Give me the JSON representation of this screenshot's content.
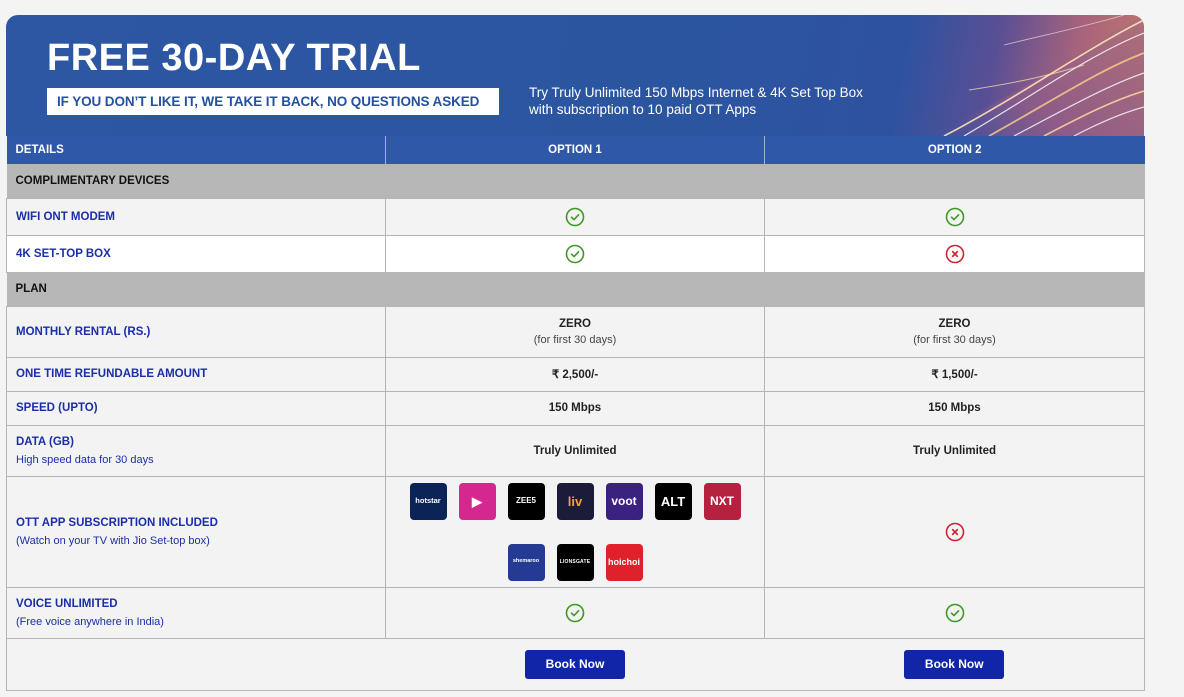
{
  "banner": {
    "title": "FREE 30-DAY TRIAL",
    "tagline": "IF YOU DON’T LIKE IT, WE TAKE IT BACK, NO QUESTIONS ASKED",
    "subtitle_line1": "Try Truly Unlimited 150 Mbps Internet & 4K Set Top Box",
    "subtitle_line2": "with subscription to 10 paid OTT Apps"
  },
  "table": {
    "headers": [
      "DETAILS",
      "OPTION 1",
      "OPTION 2"
    ],
    "sections": {
      "devices": "COMPLIMENTARY DEVICES",
      "plan": "PLAN"
    },
    "rows": {
      "wifi": {
        "label": "WIFI ONT MODEM",
        "option1": "check-icon",
        "option2": "check-icon"
      },
      "stb": {
        "label": "4K SET-TOP BOX",
        "option1": "check-icon",
        "option2": "cross-icon"
      },
      "rental": {
        "label": "MONTHLY RENTAL (RS.)",
        "option1_main": "ZERO",
        "option1_sub": "(for first 30 days)",
        "option2_main": "ZERO",
        "option2_sub": "(for first 30 days)"
      },
      "refundable": {
        "label": "ONE TIME REFUNDABLE AMOUNT",
        "option1": "₹ 2,500/-",
        "option2": "₹ 1,500/-"
      },
      "speed": {
        "label": "SPEED (UPTO)",
        "option1": "150 Mbps",
        "option2": "150 Mbps"
      },
      "data": {
        "label": "DATA (GB)",
        "sublabel": "High speed data for 30 days",
        "option1": "Truly Unlimited",
        "option2": "Truly Unlimited"
      },
      "ott": {
        "label": "OTT APP SUBSCRIPTION INCLUDED",
        "sublabel": "(Watch on your TV with Jio Set-top box)",
        "option1_apps": [
          {
            "name": "Disney+ Hotstar",
            "text": "hotstar",
            "bg": "#0c2358"
          },
          {
            "name": "JioCinema",
            "text": "▶",
            "bg": "#d5288e"
          },
          {
            "name": "ZEE5",
            "text": "ZEE5",
            "bg": "#000000"
          },
          {
            "name": "Sony LIV",
            "text": "liv",
            "bg": "#1b1b3a"
          },
          {
            "name": "Voot",
            "text": "voot",
            "bg": "#3b2180"
          },
          {
            "name": "ALTBalaji",
            "text": "ALT",
            "bg": "#000000"
          },
          {
            "name": "Sun NXT",
            "text": "NXT",
            "bg": "#b5213f"
          },
          {
            "name": "Shemaroo",
            "text": "shemaroo",
            "bg": "#253a92"
          },
          {
            "name": "Lionsgate Play",
            "text": "LIONSGATE",
            "bg": "#000000"
          },
          {
            "name": "Hoichoi",
            "text": "hoichoi",
            "bg": "#e0202b"
          }
        ],
        "option2": "cross-icon"
      },
      "voice": {
        "label": "VOICE UNLIMITED",
        "sublabel": "(Free voice anywhere in India)",
        "option1": "check-icon",
        "option2": "check-icon"
      }
    },
    "book_label": "Book Now"
  },
  "colors": {
    "accent_blue": "#2f58a8",
    "label_blue": "#1a2ea8",
    "button_blue": "#1125a8",
    "check_green": "#3e9a24",
    "cross_red": "#d1232f",
    "section_gray": "#b7b7b7"
  }
}
